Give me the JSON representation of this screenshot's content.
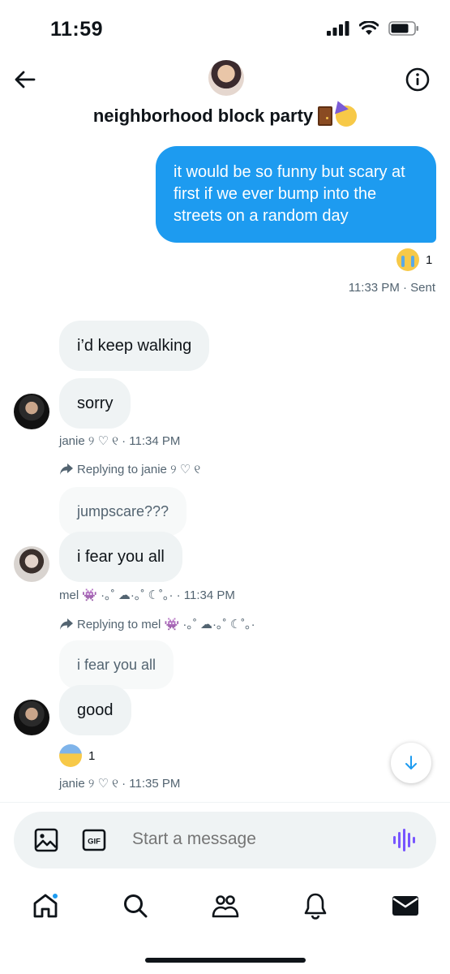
{
  "status": {
    "time": "11:59"
  },
  "header": {
    "title": "neighborhood block party"
  },
  "messages": {
    "sent_1": {
      "text": "it would be so funny but scary at first if we ever bump into the streets on a random day",
      "reaction_count": "1",
      "meta": "11:33 PM · Sent"
    },
    "recv_1": {
      "text": "i’d keep walking"
    },
    "recv_2": {
      "text": "sorry",
      "meta": "janie ୨ ♡ ୧ · 11:34 PM"
    },
    "reply_1": {
      "label": "Replying to janie ୨ ♡ ୧",
      "quote": "jumpscare???",
      "text": "i fear you all",
      "meta": "mel 👾 ·｡˚ ☁︎·｡˚ ☾˚｡· · 11:34 PM"
    },
    "reply_2": {
      "label": "Replying to mel 👾 ·｡˚ ☁︎·｡˚ ☾˚｡·",
      "quote": "i fear you all",
      "text": "good",
      "reaction_count": "1",
      "meta": "janie ୨ ♡ ୧ · 11:35 PM"
    }
  },
  "composer": {
    "placeholder": "Start a message",
    "gif_label": "GIF"
  },
  "colors": {
    "accent": "#1d9bf0",
    "bubble_received": "#eff3f4",
    "secondary_text": "#536471",
    "voice": "#7856ff"
  },
  "icons": [
    "back-arrow-icon",
    "info-icon",
    "image-icon",
    "gif-icon",
    "voice-icon",
    "home-icon",
    "search-icon",
    "communities-icon",
    "bell-icon",
    "mail-icon",
    "arrow-down-icon"
  ]
}
